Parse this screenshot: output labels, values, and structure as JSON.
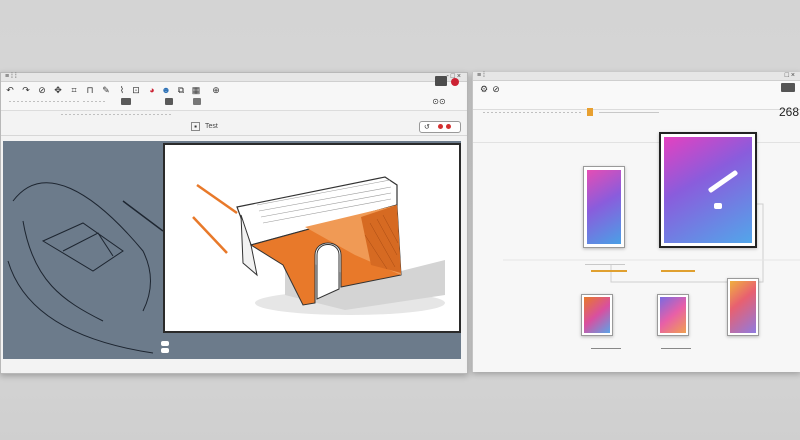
{
  "left_window": {
    "doc_label": "Test",
    "title_controls": "- □ ×"
  },
  "right_window": {
    "title_controls": "□ ×",
    "counter": "268",
    "tiles": 3
  },
  "colors": {
    "accent": "#e8792a",
    "canvas_bg": "#6c7b8b",
    "record": "#d33030"
  },
  "icons": [
    "back-icon",
    "forward-icon",
    "link-icon",
    "move-icon",
    "pen-icon",
    "brush-icon",
    "color-icon",
    "palette-icon",
    "layers-icon",
    "trash-icon",
    "grid-icon",
    "zoom-icon",
    "settings-icon"
  ]
}
